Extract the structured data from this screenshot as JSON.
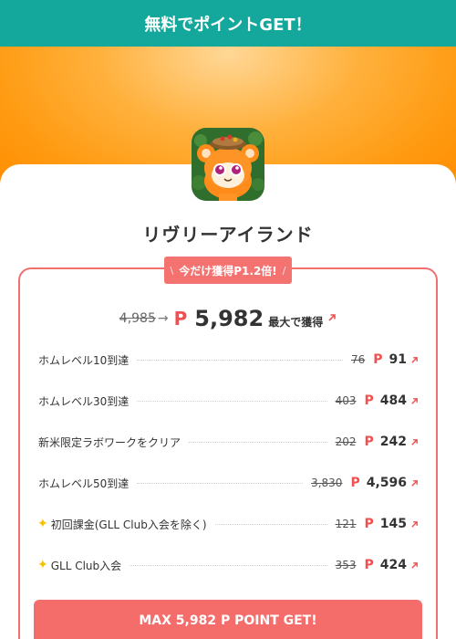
{
  "header": {
    "title": "無料でポイントGET！"
  },
  "app": {
    "name": "リヴリーアイランド",
    "icon": "app-character-icon"
  },
  "badge": {
    "text": "今だけ獲得P1.2倍!"
  },
  "total": {
    "old": "4,985",
    "p_label": "P",
    "new": "5,982",
    "max_label": "最大で獲得"
  },
  "tasks": [
    {
      "label": "ホムレベル10到達",
      "old": "76",
      "p": "P",
      "new": "91",
      "sparkle": false
    },
    {
      "label": "ホムレベル30到達",
      "old": "403",
      "p": "P",
      "new": "484",
      "sparkle": false
    },
    {
      "label": "新米限定ラボワークをクリア",
      "old": "202",
      "p": "P",
      "new": "242",
      "sparkle": false
    },
    {
      "label": "ホムレベル50到達",
      "old": "3,830",
      "p": "P",
      "new": "4,596",
      "sparkle": false
    },
    {
      "label": "初回課金(GLL Club入会を除く)",
      "old": "121",
      "p": "P",
      "new": "145",
      "sparkle": true
    },
    {
      "label": "GLL Club入会",
      "old": "353",
      "p": "P",
      "new": "424",
      "sparkle": true
    }
  ],
  "cta": {
    "label": "MAX 5,982 P POINT GET!"
  },
  "colors": {
    "header": "#14a79c",
    "accent": "#f46d6b",
    "banner": "#ff9a10",
    "sparkle": "#f5c200"
  }
}
